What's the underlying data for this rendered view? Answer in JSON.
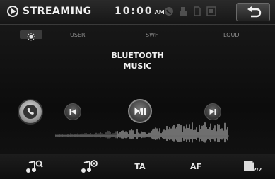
{
  "header": {
    "title": "STREAMING",
    "time": "10:00",
    "ampm": "AM",
    "status_icons": [
      "phone-icon",
      "usb-icon",
      "sd-card-icon",
      "dt-icon"
    ],
    "back_icon": "back-arrow-icon"
  },
  "eq": {
    "labels": [
      "USER",
      "SWF",
      "LOUD"
    ],
    "brightness_icon": "sun-icon"
  },
  "source": {
    "line1": "BLUETOOTH",
    "line2": "MUSIC"
  },
  "controls": {
    "phone_icon": "phone-icon",
    "prev_icon": "previous-track-icon",
    "play_pause_icon": "play-pause-icon",
    "next_icon": "next-track-icon"
  },
  "bottom": {
    "ta": "TA",
    "af": "AF",
    "page_text": "2/2",
    "left_icon": "music-search-icon",
    "second_icon": "music-scan-icon"
  },
  "colors": {
    "text": "#f1f1f1",
    "muted": "#8d8d8d",
    "background": "#121212"
  }
}
